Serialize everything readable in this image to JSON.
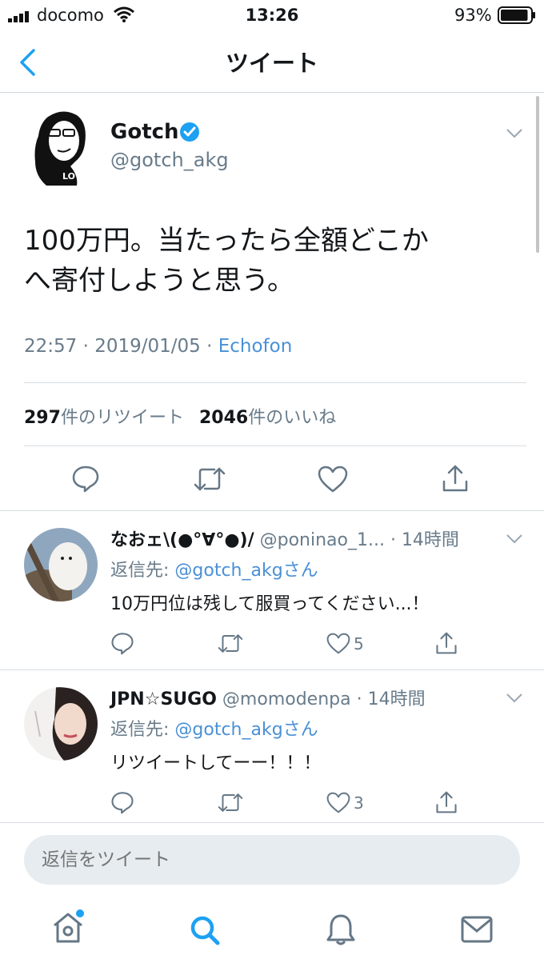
{
  "status_bar": {
    "carrier": "docomo",
    "time": "13:26",
    "battery": "93%",
    "battery_level": 0.93
  },
  "nav": {
    "title": "ツイート",
    "back_icon": "chevron-left-icon"
  },
  "tweet": {
    "author_name": "Gotch",
    "handle": "@gotch_akg",
    "text_line1": "100万円。当たったら全額どこか",
    "text_line2": "へ寄付しようと思う。",
    "timestamp": "22:57 · 2019/01/05 · ",
    "client": "Echofon",
    "retweet_count": "297",
    "retweet_label": "件のリツイート",
    "like_count": "2046",
    "like_label": "件のいいね"
  },
  "replies": [
    {
      "name": "なおェ\\(●°∀°●)/",
      "handle": "@poninao_1...",
      "time": "· 14時間",
      "reply_prefix": "返信先: ",
      "reply_to": "@gotch_akgさん",
      "text": "10万円位は残して服買ってください...！",
      "like_count": "5"
    },
    {
      "name": "JPN☆SUGO",
      "handle": "@momodenpa",
      "time": "· 14時間",
      "reply_prefix": "返信先: ",
      "reply_to": "@gotch_akgさん",
      "text": "リツイートしてーー！！！",
      "like_count": "3"
    }
  ],
  "reply_box": {
    "placeholder": "返信をツイート"
  },
  "tab_bar": {
    "items": [
      "home-icon",
      "search-icon",
      "notifications-icon",
      "messages-icon"
    ]
  },
  "colors": {
    "accent": "#1da1f2",
    "link": "#4a90d6",
    "muted": "#687b8a"
  }
}
